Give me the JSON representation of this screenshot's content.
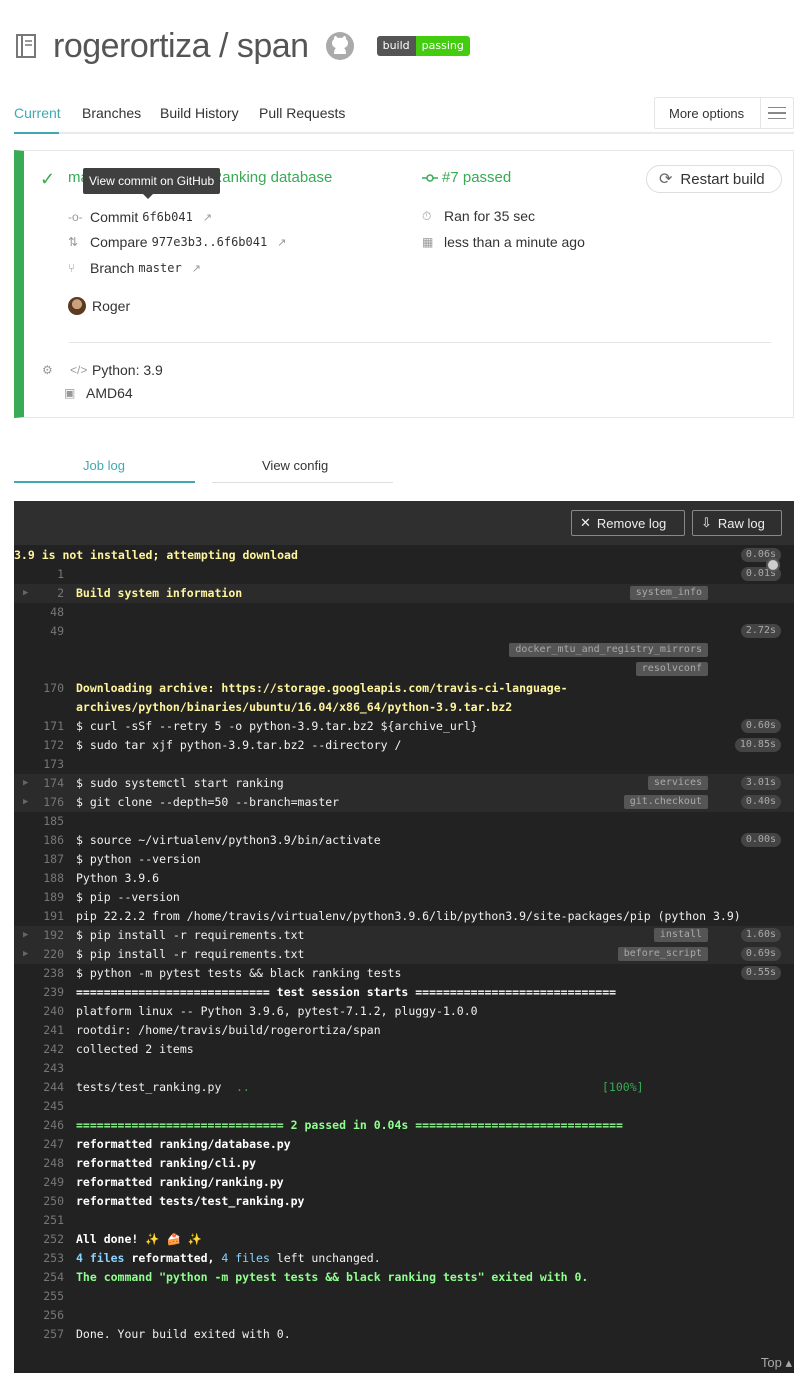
{
  "header": {
    "repo_title": "rogerortiza / span",
    "badge_left": "build",
    "badge_right": "passing"
  },
  "tabs": [
    "Current",
    "Branches",
    "Build History",
    "Pull Requests"
  ],
  "more_options": "More options",
  "build": {
    "commit_message": "make changes to the Ranking database",
    "tooltip": "View commit on GitHub",
    "build_status": "#7 passed",
    "restart_label": "Restart build",
    "commit_label": "Commit",
    "commit_hash": "6f6b041",
    "compare_label": "Compare",
    "compare_range": "977e3b3..6f6b041",
    "branch_label": "Branch",
    "branch_name": "master",
    "author": "Roger",
    "duration": "Ran for 35 sec",
    "finished": "less than a minute ago",
    "language": "Python: 3.9",
    "arch": "AMD64"
  },
  "job_tabs": [
    "Job log",
    "View config"
  ],
  "log_buttons": {
    "remove": "Remove log",
    "raw": "Raw log"
  },
  "log_top": "Top",
  "log_lines": [
    {
      "num": "",
      "text": "3.9 is not installed; attempting download",
      "style": "y",
      "time": "0.06s",
      "tag": "",
      "fold": false
    },
    {
      "num": "1",
      "text": "",
      "style": "",
      "time": "0.01s",
      "tag": "",
      "fold": false
    },
    {
      "num": "2",
      "text": "Build system information",
      "style": "y",
      "time": "",
      "tag": "system_info",
      "fold": true
    },
    {
      "num": "48",
      "text": "",
      "style": "",
      "time": "",
      "tag": "",
      "fold": false
    },
    {
      "num": "49",
      "text": "",
      "style": "",
      "time": "2.72s",
      "tag": "",
      "fold": false
    },
    {
      "num": "",
      "text": "",
      "style": "",
      "time": "",
      "tag": "docker_mtu_and_registry_mirrors",
      "fold": false
    },
    {
      "num": "",
      "text": "",
      "style": "",
      "time": "",
      "tag": "resolvconf",
      "fold": false
    },
    {
      "num": "170",
      "text": "Downloading archive: https://storage.googleapis.com/travis-ci-language-",
      "style": "y",
      "time": "",
      "tag": "",
      "fold": false
    },
    {
      "num": "",
      "text": "archives/python/binaries/ubuntu/16.04/x86_64/python-3.9.tar.bz2",
      "style": "y",
      "time": "",
      "tag": "",
      "fold": false
    },
    {
      "num": "171",
      "text": "$ curl -sSf --retry 5 -o python-3.9.tar.bz2 ${archive_url}",
      "style": "",
      "time": "0.60s",
      "tag": "",
      "fold": false
    },
    {
      "num": "172",
      "text": "$ sudo tar xjf python-3.9.tar.bz2 --directory /",
      "style": "",
      "time": "10.85s",
      "tag": "",
      "fold": false
    },
    {
      "num": "173",
      "text": "",
      "style": "",
      "time": "",
      "tag": "",
      "fold": false
    },
    {
      "num": "174",
      "text": "$ sudo systemctl start ranking",
      "style": "",
      "time": "3.01s",
      "tag": "services",
      "fold": true
    },
    {
      "num": "176",
      "text": "$ git clone --depth=50 --branch=master",
      "style": "",
      "time": "0.40s",
      "tag": "git.checkout",
      "fold": true
    },
    {
      "num": "185",
      "text": "",
      "style": "",
      "time": "",
      "tag": "",
      "fold": false
    },
    {
      "num": "186",
      "text": "$ source ~/virtualenv/python3.9/bin/activate",
      "style": "",
      "time": "0.00s",
      "tag": "",
      "fold": false
    },
    {
      "num": "187",
      "text": "$ python --version",
      "style": "",
      "time": "",
      "tag": "",
      "fold": false
    },
    {
      "num": "188",
      "text": "Python 3.9.6",
      "style": "",
      "time": "",
      "tag": "",
      "fold": false
    },
    {
      "num": "189",
      "text": "$ pip --version",
      "style": "",
      "time": "",
      "tag": "",
      "fold": false
    },
    {
      "num": "191",
      "text": "pip 22.2.2 from /home/travis/virtualenv/python3.9.6/lib/python3.9/site-packages/pip (python 3.9)",
      "style": "",
      "time": "",
      "tag": "",
      "fold": false
    },
    {
      "num": "192",
      "text": "$ pip install -r requirements.txt",
      "style": "",
      "time": "1.60s",
      "tag": "install",
      "fold": true
    },
    {
      "num": "220",
      "text": "$ pip install -r requirements.txt",
      "style": "",
      "time": "0.69s",
      "tag": "before_script",
      "fold": true
    },
    {
      "num": "238",
      "text": "$ python -m pytest tests && black ranking tests",
      "style": "",
      "time": "0.55s",
      "tag": "",
      "fold": false
    },
    {
      "num": "239",
      "text": "============================ test session starts =============================",
      "style": "w",
      "time": "",
      "tag": "",
      "fold": false
    },
    {
      "num": "240",
      "text": "platform linux -- Python 3.9.6, pytest-7.1.2, pluggy-1.0.0",
      "style": "",
      "time": "",
      "tag": "",
      "fold": false
    },
    {
      "num": "241",
      "text": "rootdir: /home/travis/build/rogerortiza/span",
      "style": "",
      "time": "",
      "tag": "",
      "fold": false
    },
    {
      "num": "242",
      "text": "collected 2 items",
      "style": "",
      "time": "",
      "tag": "",
      "fold": false
    },
    {
      "num": "243",
      "text": "",
      "style": "",
      "time": "",
      "tag": "",
      "fold": false
    },
    {
      "num": "244",
      "text": "tests/test_ranking.py",
      "style": "",
      "time": "",
      "tag": "",
      "fold": false,
      "suffix": " ..",
      "right": "[100%]"
    },
    {
      "num": "245",
      "text": "",
      "style": "",
      "time": "",
      "tag": "",
      "fold": false
    },
    {
      "num": "246",
      "text": "============================== 2 passed in 0.04s ==============================",
      "style": "g",
      "time": "",
      "tag": "",
      "fold": false
    },
    {
      "num": "247",
      "text": "reformatted ranking/database.py",
      "style": "w",
      "time": "",
      "tag": "",
      "fold": false
    },
    {
      "num": "248",
      "text": "reformatted ranking/cli.py",
      "style": "w",
      "time": "",
      "tag": "",
      "fold": false
    },
    {
      "num": "249",
      "text": "reformatted ranking/ranking.py",
      "style": "w",
      "time": "",
      "tag": "",
      "fold": false
    },
    {
      "num": "250",
      "text": "reformatted tests/test_ranking.py",
      "style": "w",
      "time": "",
      "tag": "",
      "fold": false
    },
    {
      "num": "251",
      "text": "",
      "style": "",
      "time": "",
      "tag": "",
      "fold": false
    },
    {
      "num": "252",
      "text": "All done! ✨ 🍰 ✨",
      "style": "w",
      "time": "",
      "tag": "",
      "fold": false
    },
    {
      "num": "253",
      "text": "4 files reformatted, 4 files left unchanged.",
      "style": "",
      "time": "",
      "tag": "",
      "fold": false
    },
    {
      "num": "254",
      "text": "The command \"python -m pytest tests && black ranking tests\" exited with 0.",
      "style": "g",
      "time": "",
      "tag": "",
      "fold": false
    },
    {
      "num": "255",
      "text": "",
      "style": "",
      "time": "",
      "tag": "",
      "fold": false
    },
    {
      "num": "256",
      "text": "",
      "style": "",
      "time": "",
      "tag": "",
      "fold": false
    },
    {
      "num": "257",
      "text": "Done. Your build exited with 0.",
      "style": "",
      "time": "",
      "tag": "",
      "fold": false
    }
  ]
}
